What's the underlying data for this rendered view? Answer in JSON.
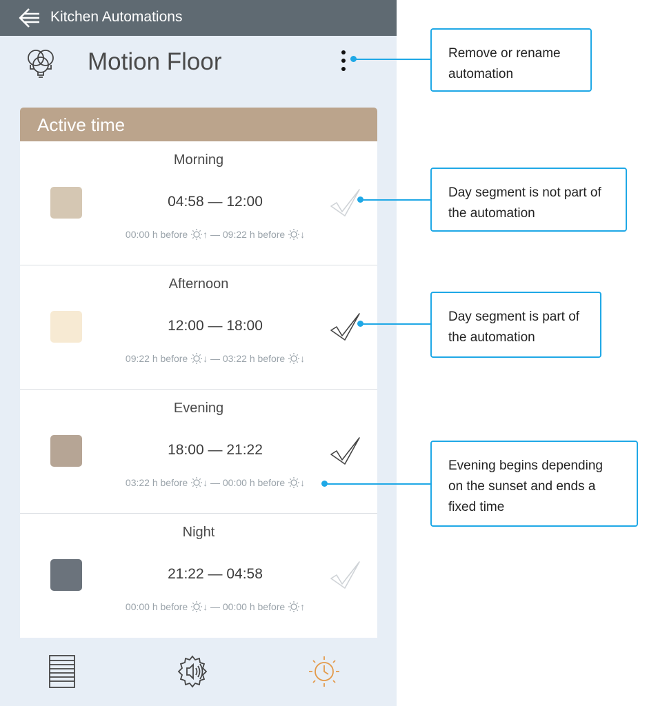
{
  "topbar": {
    "title": "Kitchen Automations"
  },
  "header": {
    "title": "Motion Floor"
  },
  "section": {
    "title": "Active time"
  },
  "segments": [
    {
      "name": "Morning",
      "time": "04:58 — 12:00",
      "detail_start": "00:00 h before",
      "start_dir": "up",
      "detail_end": "09:22 h before",
      "end_dir": "down",
      "color": "#d5c7b3",
      "included": false
    },
    {
      "name": "Afternoon",
      "time": "12:00 — 18:00",
      "detail_start": "09:22 h before",
      "start_dir": "down",
      "detail_end": "03:22 h before",
      "end_dir": "down",
      "color": "#f7ead3",
      "included": true
    },
    {
      "name": "Evening",
      "time": "18:00 — 21:22",
      "detail_start": "03:22 h before",
      "start_dir": "down",
      "detail_end": "00:00 h before",
      "end_dir": "down",
      "color": "#b6a595",
      "included": true
    },
    {
      "name": "Night",
      "time": "21:22 — 04:58",
      "detail_start": "00:00 h before",
      "start_dir": "down",
      "detail_end": "00:00 h before",
      "end_dir": "up",
      "color": "#6b737c",
      "included": false
    }
  ],
  "nav": {
    "items": [
      "list-icon",
      "gear-sound-icon",
      "sun-clock-icon"
    ],
    "active_color": "#e39a4a"
  },
  "callouts": {
    "menu": "Remove or rename automation",
    "not_part": "Day segment is not part of the automation",
    "part": "Day segment is part of the automation",
    "evening": "Evening begins depending on the sunset and ends a fixed time"
  },
  "colors": {
    "topbar": "#5f6a72",
    "section_header": "#bba48c",
    "background": "#e7eef6",
    "accent": "#1fa8e6"
  }
}
